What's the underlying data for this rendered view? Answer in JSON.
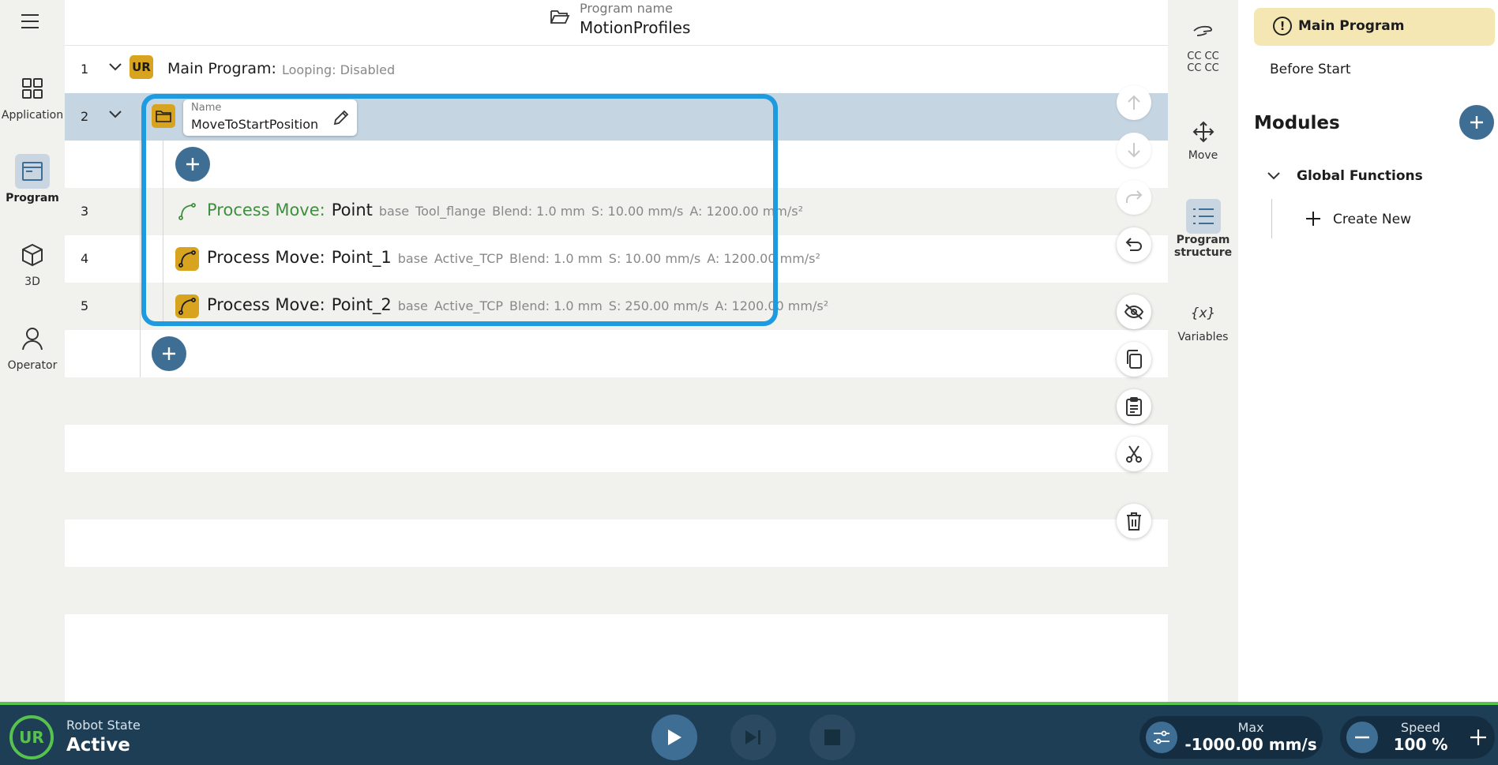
{
  "nav": {
    "items": [
      {
        "label": "Application",
        "icon": "grid-icon"
      },
      {
        "label": "Program",
        "icon": "program-icon"
      },
      {
        "label": "3D",
        "icon": "cube-icon"
      },
      {
        "label": "Operator",
        "icon": "person-icon"
      }
    ],
    "active": "Program"
  },
  "header": {
    "program_label": "Program name",
    "program_name": "MotionProfiles"
  },
  "tree": {
    "main": {
      "line": "1",
      "title": "Main Program:",
      "looping_label": "Looping:",
      "looping_value": "Disabled"
    },
    "group": {
      "line": "2",
      "name_label": "Name",
      "name_value": "MoveToStartPosition"
    },
    "moves": [
      {
        "line": "3",
        "title": "Process Move:",
        "point": "Point",
        "frame_label": "base",
        "tcp": "Tool_flange",
        "blend": "Blend: 1.0 mm",
        "speed": "S: 10.00 mm/s",
        "accel": "A: 1200.00 mm/s²"
      },
      {
        "line": "4",
        "title": "Process Move:",
        "point": "Point_1",
        "frame_label": "base",
        "tcp": "Active_TCP",
        "blend": "Blend: 1.0 mm",
        "speed": "S: 10.00 mm/s",
        "accel": "A: 1200.00 mm/s²"
      },
      {
        "line": "5",
        "title": "Process Move:",
        "point": "Point_2",
        "frame_label": "base",
        "tcp": "Active_TCP",
        "blend": "Blend: 1.0 mm",
        "speed": "S: 250.00 mm/s",
        "accel": "A: 1200.00 mm/s²"
      }
    ]
  },
  "sidebar": {
    "cc": "CC CC\nCC CC",
    "move": "Move",
    "structure": "Program structure",
    "variables": "Variables"
  },
  "panel": {
    "main_program": "Main Program",
    "before_start": "Before Start",
    "modules": "Modules",
    "global_functions": "Global Functions",
    "create_new": "Create New"
  },
  "footer": {
    "robot_state_label": "Robot State",
    "robot_state_value": "Active",
    "max_label": "Max",
    "max_value": "-1000.00 mm/s",
    "speed_label": "Speed",
    "speed_value": "100 %"
  },
  "colors": {
    "accent": "#3f6e94",
    "highlight": "#1e9be0",
    "status_green": "#58c24e",
    "ur_yellow": "#d8a31f",
    "footer_bg": "#1e3e56"
  }
}
